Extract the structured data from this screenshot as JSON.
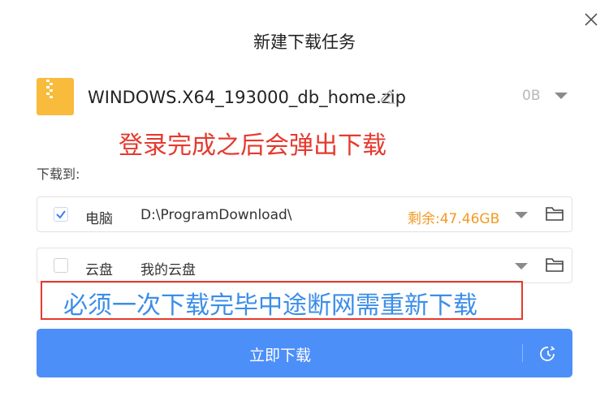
{
  "dialog": {
    "title": "新建下载任务"
  },
  "file": {
    "name": "WINDOWS.X64_193000_db_home.zip",
    "size": "0B",
    "icon": "zip-file-icon"
  },
  "annotations": {
    "top_note": "登录完成之后会弹出下载",
    "bottom_note": "必须一次下载完毕中途断网需重新下载"
  },
  "save_to": {
    "label": "下载到:",
    "pc": {
      "label": "电脑",
      "path": "D:\\ProgramDownload\\",
      "space": "剩余:47.46GB",
      "checked": true
    },
    "cloud": {
      "label": "云盘",
      "path": "我的云盘",
      "checked": false
    }
  },
  "actions": {
    "download_now": "立即下载"
  },
  "colors": {
    "primary": "#4d8ff9",
    "annotation_red": "#e53a2f",
    "annotation_blue": "#3b8ee8",
    "space_orange": "#f39a23",
    "file_icon": "#f8bb3c"
  }
}
